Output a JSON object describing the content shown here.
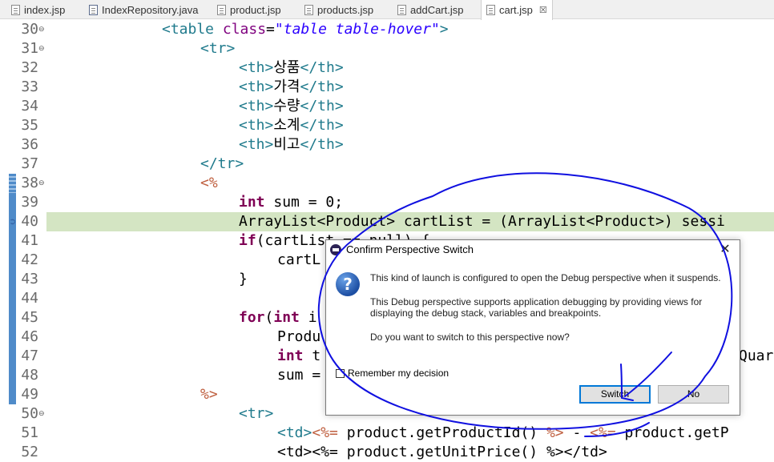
{
  "tabs": [
    {
      "label": "index.jsp",
      "type": "jsp"
    },
    {
      "label": "IndexRepository.java",
      "type": "java"
    },
    {
      "label": "product.jsp",
      "type": "jsp"
    },
    {
      "label": "products.jsp",
      "type": "jsp"
    },
    {
      "label": "addCart.jsp",
      "type": "jsp"
    },
    {
      "label": "cart.jsp",
      "type": "jsp",
      "active": true,
      "close": "☒"
    }
  ],
  "editor": {
    "line_numbers": [
      "30",
      "31",
      "32",
      "33",
      "34",
      "35",
      "36",
      "37",
      "38",
      "39",
      "40",
      "41",
      "42",
      "43",
      "44",
      "45",
      "46",
      "47",
      "48",
      "49",
      "50",
      "51",
      "52"
    ],
    "current_line": "40",
    "code": {
      "l30_open": "<table ",
      "l30_attr": "class",
      "l30_eq": "=",
      "l30_val": "\"table table-hover\"",
      "l30_close": ">",
      "l31": "<tr>",
      "l32_open": "<th>",
      "l32_text": "상품",
      "l32_close": "</th>",
      "l33_open": "<th>",
      "l33_text": "가격",
      "l33_close": "</th>",
      "l34_open": "<th>",
      "l34_text": "수량",
      "l34_close": "</th>",
      "l35_open": "<th>",
      "l35_text": "소계",
      "l35_close": "</th>",
      "l36_open": "<th>",
      "l36_text": "비고",
      "l36_close": "</th>",
      "l37": "</tr>",
      "l38": "<%",
      "l39_kw": "int",
      "l39_rest": " sum = 0;",
      "l40": "ArrayList<Product> cartList = (ArrayList<Product>) sessi",
      "l41_kw": "if",
      "l41_rest": "(cartList == null) {",
      "l42": "cartL",
      "l43": "}",
      "l45_kw1": "for",
      "l45_mid": "(",
      "l45_kw2": "int",
      "l45_rest": " i",
      "l46": "Produ",
      "l47_kw": "int",
      "l47_rest": " t",
      "l47_tail": "Quar",
      "l48": "sum =",
      "l49": "%>",
      "l50": "<tr>",
      "l51_td": "<td>",
      "l51_open": "<%=",
      "l51_expr": " product.getProductId() ",
      "l51_close": "%>",
      "l51_dash": " - ",
      "l51_open2": "<%=",
      "l51_expr2": " product.getP",
      "l52": "<td><%= product.getUnitPrice() %></td>"
    }
  },
  "dialog": {
    "title": "Confirm Perspective Switch",
    "close": "✕",
    "icon": "question-icon",
    "message1": "This kind of launch is configured to open the Debug perspective when it suspends.",
    "message2a": "This Debug perspective supports application debugging by providing views for",
    "message2b": "displaying the debug stack, variables and breakpoints.",
    "message3": "Do you want to switch to this perspective now?",
    "remember_label": "Remember my decision",
    "remember_checked": false,
    "switch_label": "Switch",
    "no_label": "No"
  },
  "colors": {
    "current_line": "#d4e5c3",
    "breakpoint_bar": "#4f8bc9",
    "annotation_ink": "#1010e0",
    "default_button_border": "#0078d7"
  }
}
